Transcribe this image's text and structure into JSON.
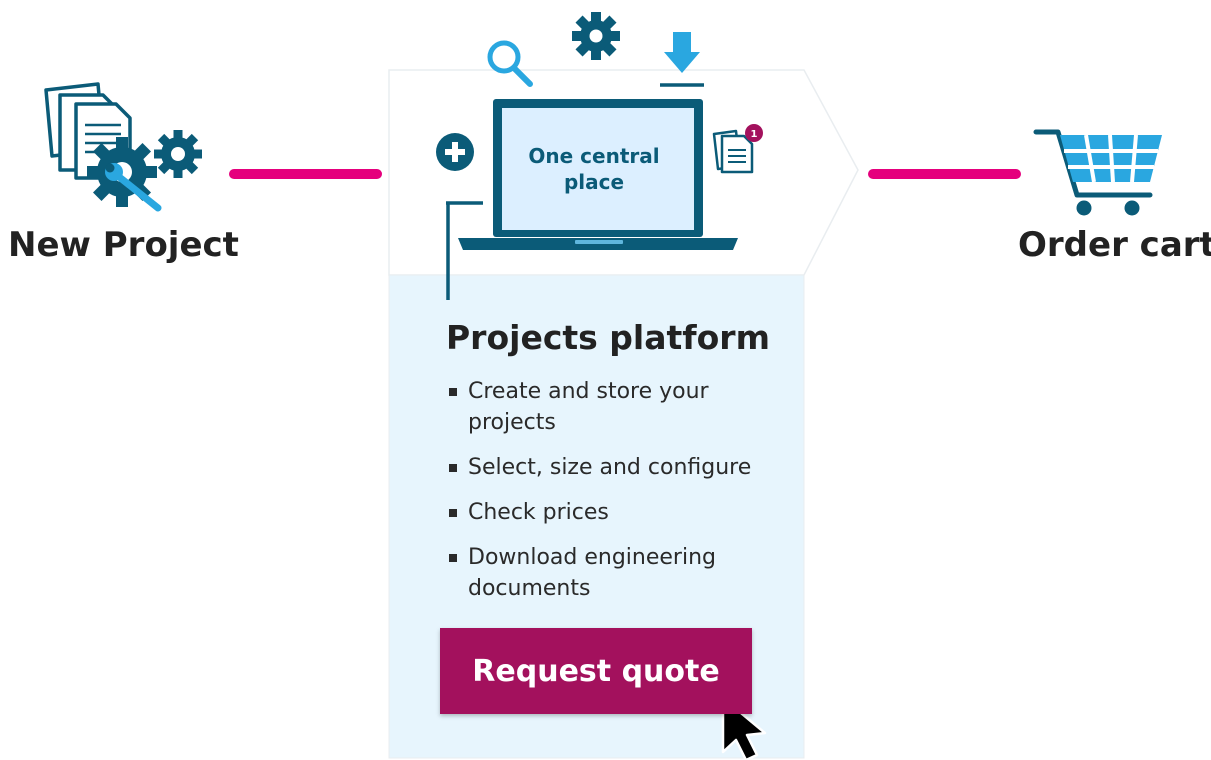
{
  "steps": {
    "left_label": "New Project",
    "right_label": "Order cart"
  },
  "center": {
    "screen_text_line1": "One central",
    "screen_text_line2": "place",
    "notification_count": "1",
    "title": "Projects platform",
    "features": [
      "Create and store your projects",
      "Select, size and configure",
      "Check prices",
      "Download engineering documents"
    ],
    "cta_label": "Request quote"
  },
  "colors": {
    "dark_teal": "#0b5b78",
    "light_blue": "#2aa7e0",
    "screen_fill": "#dcefff",
    "panel_fill": "#e7f5fd",
    "connector_magenta": "#e5007d",
    "cta_purple": "#a3115d"
  },
  "icons": {
    "new_project": "documents-with-gears-icon",
    "laptop": "laptop-icon",
    "search": "search-icon",
    "settings": "gear-icon",
    "download": "download-icon",
    "add": "plus-circle-icon",
    "documents": "documents-notification-icon",
    "cart": "shopping-cart-icon",
    "cursor": "mouse-pointer-icon"
  }
}
